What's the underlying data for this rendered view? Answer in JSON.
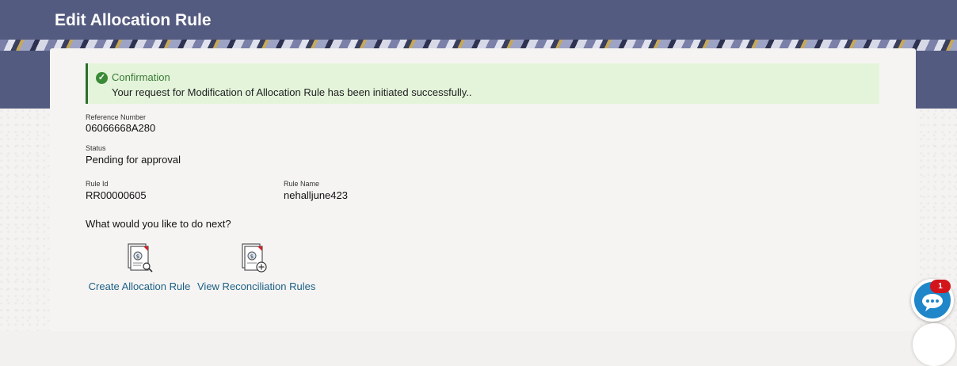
{
  "header": {
    "title": "Edit Allocation Rule"
  },
  "confirmation": {
    "title": "Confirmation",
    "message": "Your request for Modification of Allocation Rule has been initiated successfully.."
  },
  "details": {
    "reference_number": {
      "label": "Reference Number",
      "value": "06066668A280"
    },
    "status": {
      "label": "Status",
      "value": "Pending for approval"
    },
    "rule_id": {
      "label": "Rule Id",
      "value": "RR00000605"
    },
    "rule_name": {
      "label": "Rule Name",
      "value": "nehalljune423"
    }
  },
  "next_steps": {
    "question": "What would you like to do next?",
    "actions": [
      {
        "label": "Create Allocation Rule",
        "icon": "document-search-icon"
      },
      {
        "label": "View Reconciliation Rules",
        "icon": "document-add-icon"
      }
    ]
  },
  "chat": {
    "badge_count": "1",
    "icon": "chat-icon"
  },
  "colors": {
    "header_bg": "#545b80",
    "confirmation_bg": "#e3f4da",
    "link": "#1b5f87",
    "chat_button": "#1e86c9",
    "badge": "#d3141b"
  }
}
